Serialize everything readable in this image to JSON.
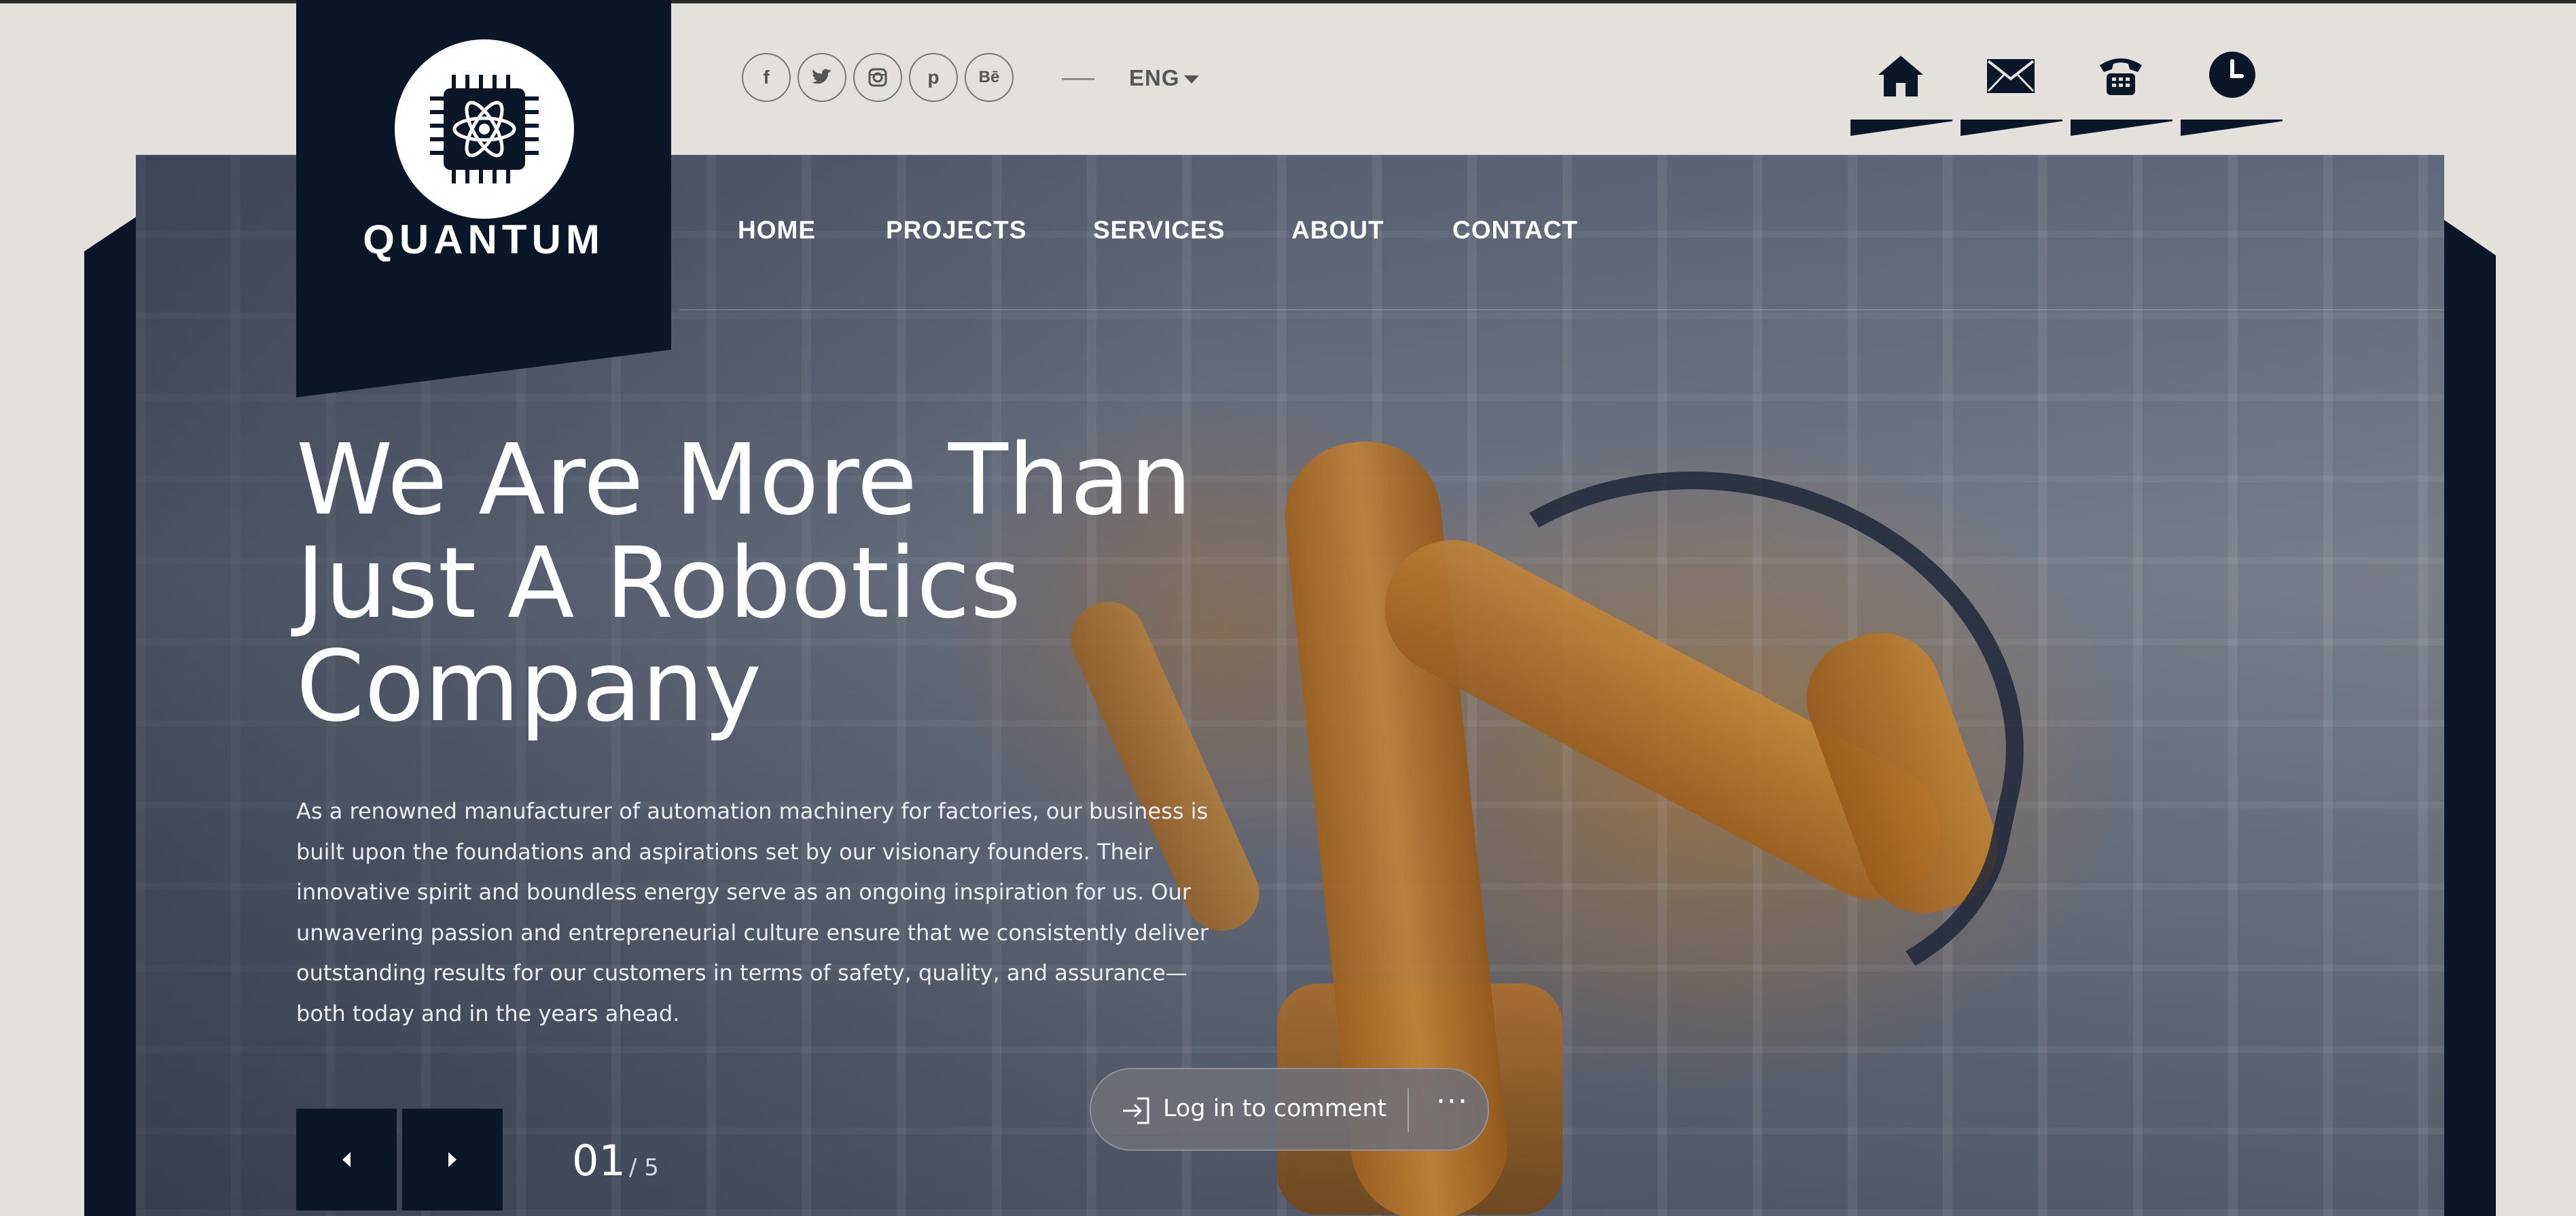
{
  "brand": {
    "name": "QUANTUM",
    "logo_icon": "atom-chip-icon"
  },
  "top_bar": {
    "socials": [
      {
        "name": "facebook",
        "glyph": "f"
      },
      {
        "name": "twitter",
        "glyph": "t"
      },
      {
        "name": "instagram",
        "glyph": "◘"
      },
      {
        "name": "pinterest",
        "glyph": "p"
      },
      {
        "name": "behance",
        "glyph": "Bē"
      }
    ],
    "language": "ENG",
    "quick_icons": [
      "home-icon",
      "mail-icon",
      "phone-icon",
      "clock-icon"
    ]
  },
  "nav": {
    "items": [
      "HOME",
      "PROJECTS",
      "SERVICES",
      "ABOUT",
      "CONTACT"
    ]
  },
  "hero": {
    "headline": [
      "We Are More Than",
      "Just A Robotics",
      "Company"
    ],
    "paragraph": [
      "As a renowned manufacturer of automation machinery for factories, our business is",
      "built upon the foundations and aspirations set by our visionary founders. Their",
      "innovative spirit and boundless energy serve as an ongoing inspiration for us. Our",
      "unwavering passion and entrepreneurial culture ensure that we consistently deliver",
      "outstanding results for our customers in terms of safety, quality, and assurance—",
      "both today and in the years ahead."
    ],
    "slide_current": "01",
    "slide_total": "/ 5"
  },
  "comment_pill": {
    "login_label": "Log in to comment",
    "more_label": "···"
  },
  "colors": {
    "navy": "#0b1628",
    "background": "#e4e1dc",
    "accent_orange": "#f0a23a"
  }
}
